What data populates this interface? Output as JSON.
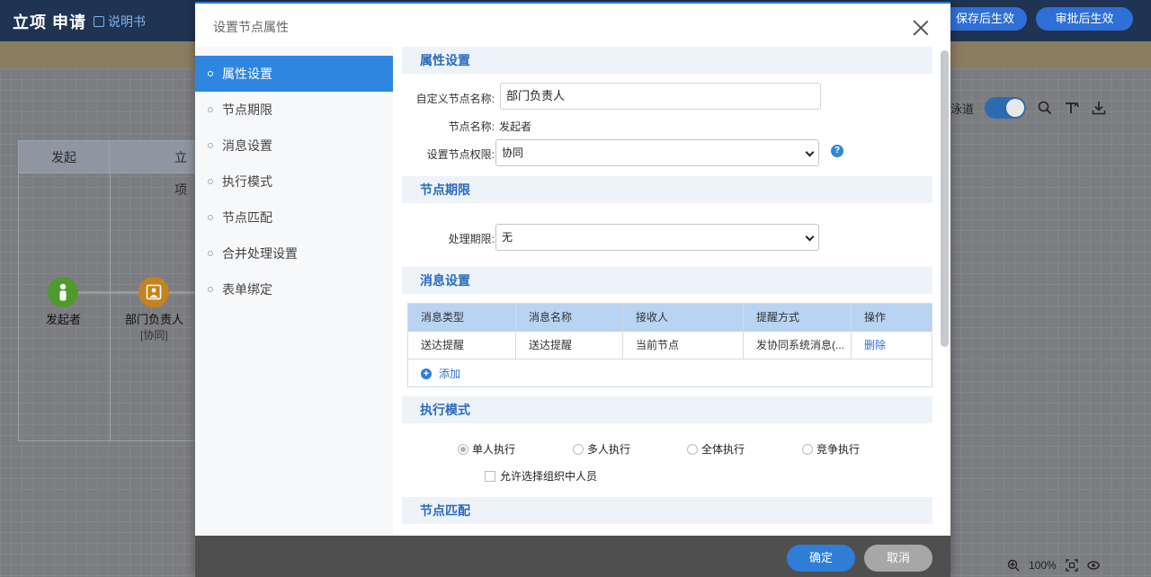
{
  "app": {
    "title": "立项 申请",
    "manual_link": "说明书",
    "save_button": "保存后生效",
    "approve_button": "审批后生效"
  },
  "canvas": {
    "lane_headers": [
      "发起",
      "立项"
    ],
    "nodes": [
      {
        "label": "发起者",
        "sub": ""
      },
      {
        "label": "部门负责人",
        "sub": "[协同]"
      }
    ],
    "swimlane_label": "泳道",
    "zoom_level": "100%"
  },
  "dialog": {
    "title": "设置节点属性",
    "nav_items": [
      "属性设置",
      "节点期限",
      "消息设置",
      "执行模式",
      "节点匹配",
      "合并处理设置",
      "表单绑定"
    ],
    "active_nav_index": 0,
    "sections": {
      "attributes": {
        "title": "属性设置",
        "custom_name_label": "自定义节点名称:",
        "custom_name_value": "部门负责人",
        "node_name_label": "节点名称:",
        "node_name_value": "发起者",
        "permission_label": "设置节点权限:",
        "permission_value": "协同"
      },
      "deadline": {
        "title": "节点期限",
        "process_deadline_label": "处理期限:",
        "process_deadline_value": "无"
      },
      "messages": {
        "title": "消息设置",
        "columns": [
          "消息类型",
          "消息名称",
          "接收人",
          "提醒方式",
          "操作"
        ],
        "rows": [
          [
            "送达提醒",
            "送达提醒",
            "当前节点",
            "发协同系统消息(...",
            "删除"
          ]
        ],
        "add_label": "添加"
      },
      "execution": {
        "title": "执行模式",
        "options": [
          "单人执行",
          "多人执行",
          "全体执行",
          "竞争执行"
        ],
        "selected_index": 0,
        "allow_org_label": "允许选择组织中人员",
        "allow_org_checked": false
      },
      "matching": {
        "title": "节点匹配"
      }
    },
    "ok_button": "确定",
    "cancel_button": "取消"
  }
}
